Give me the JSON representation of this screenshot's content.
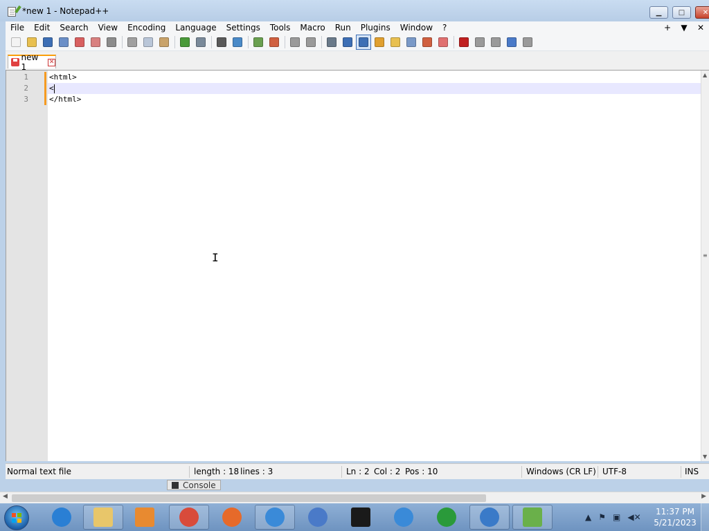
{
  "window": {
    "title": "*new 1 - Notepad++"
  },
  "window_controls": {
    "minimize": "▁",
    "maximize": "□",
    "close": "✕"
  },
  "menu": {
    "items": [
      "File",
      "Edit",
      "Search",
      "View",
      "Encoding",
      "Language",
      "Settings",
      "Tools",
      "Macro",
      "Run",
      "Plugins",
      "Window",
      "?"
    ],
    "right_plus": "+",
    "right_arrow": "▼",
    "right_close": "✕"
  },
  "toolbar": {
    "buttons": [
      {
        "name": "new-file-icon",
        "color": "#f3f3f3"
      },
      {
        "name": "open-file-icon",
        "color": "#e8c050"
      },
      {
        "name": "save-icon",
        "color": "#3d6fb5"
      },
      {
        "name": "save-all-icon",
        "color": "#6b8fc7"
      },
      {
        "name": "close-icon",
        "color": "#d86060"
      },
      {
        "name": "close-all-icon",
        "color": "#d88080"
      },
      {
        "name": "print-icon",
        "color": "#8c8c8c"
      },
      {
        "name": "sep"
      },
      {
        "name": "cut-icon",
        "color": "#a0a0a0"
      },
      {
        "name": "copy-icon",
        "color": "#b9c6d8"
      },
      {
        "name": "paste-icon",
        "color": "#c9a36a"
      },
      {
        "name": "sep"
      },
      {
        "name": "undo-icon",
        "color": "#4a9a3a"
      },
      {
        "name": "redo-icon",
        "color": "#7a8a9a"
      },
      {
        "name": "sep"
      },
      {
        "name": "find-icon",
        "color": "#5a5a5a"
      },
      {
        "name": "replace-icon",
        "color": "#4a8ac8"
      },
      {
        "name": "sep"
      },
      {
        "name": "zoom-in-icon",
        "color": "#6aa050"
      },
      {
        "name": "zoom-out-icon",
        "color": "#d06040"
      },
      {
        "name": "sep"
      },
      {
        "name": "sync-vertical-icon",
        "color": "#9a9a9a"
      },
      {
        "name": "sync-horizontal-icon",
        "color": "#9a9a9a"
      },
      {
        "name": "sep"
      },
      {
        "name": "word-wrap-icon",
        "color": "#6a7a8a"
      },
      {
        "name": "show-all-chars-icon",
        "color": "#3d6fb5"
      },
      {
        "name": "indent-guide-icon",
        "color": "#3d6fb5",
        "active": true
      },
      {
        "name": "user-language-icon",
        "color": "#e0a030"
      },
      {
        "name": "doc-map-icon",
        "color": "#e8c050"
      },
      {
        "name": "function-list-icon",
        "color": "#7a9ac8"
      },
      {
        "name": "folder-as-workspace-icon",
        "color": "#d06040"
      },
      {
        "name": "monitoring-icon",
        "color": "#e07070"
      },
      {
        "name": "sep"
      },
      {
        "name": "record-macro-icon",
        "color": "#c02020"
      },
      {
        "name": "stop-recording-icon",
        "color": "#9a9a9a"
      },
      {
        "name": "playback-macro-icon",
        "color": "#9a9a9a"
      },
      {
        "name": "run-macro-multiple-icon",
        "color": "#4a7ac8"
      },
      {
        "name": "save-macro-icon",
        "color": "#9a9a9a"
      }
    ]
  },
  "tab": {
    "label": "new 1",
    "close": "✕"
  },
  "editor": {
    "line_numbers": [
      "1",
      "2",
      "3"
    ],
    "lines": [
      "<html>",
      "<",
      "</html>"
    ],
    "current_line": 2
  },
  "statusbar": {
    "file_type": "Normal text file",
    "length": "length : 18",
    "lines": "lines : 3",
    "ln": "Ln : 2",
    "col": "Col : 2",
    "pos": "Pos : 10",
    "eol": "Windows (CR LF)",
    "encoding": "UTF-8",
    "mode": "INS"
  },
  "console": {
    "label": "Console"
  },
  "taskbar": {
    "apps": [
      {
        "name": "internet-explorer-icon",
        "color": "#2a7fd4"
      },
      {
        "name": "file-explorer-icon",
        "color": "#e8c66a"
      },
      {
        "name": "media-player-icon",
        "color": "#e88a30"
      },
      {
        "name": "chrome-icon",
        "color": "#d84b3b"
      },
      {
        "name": "firefox-icon",
        "color": "#e66a2a"
      },
      {
        "name": "dolphin-icon",
        "color": "#3a8ad8"
      },
      {
        "name": "qbittorrent-icon",
        "color": "#4a7ac8"
      },
      {
        "name": "7zip-icon",
        "color": "#1a1a1a"
      },
      {
        "name": "dolphin-shield-icon",
        "color": "#3a8ad8"
      },
      {
        "name": "download-manager-icon",
        "color": "#2a9a3a"
      },
      {
        "name": "update-shield-icon",
        "color": "#3a7ac8"
      },
      {
        "name": "notepadpp-icon",
        "color": "#6ab04a"
      }
    ],
    "tray": {
      "expand": "▲",
      "flag": "⚑",
      "network": "▣",
      "volume": "◀✕"
    },
    "clock_time": "11:37 PM",
    "clock_date": "5/21/2023"
  }
}
